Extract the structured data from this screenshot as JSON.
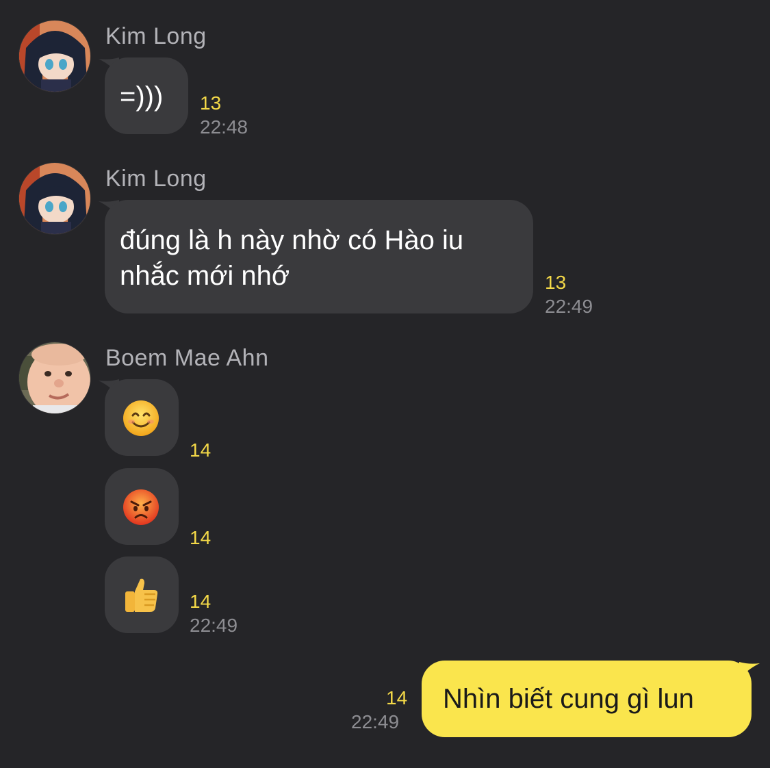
{
  "colors": {
    "background": "#252528",
    "bubble_other": "#3a3a3d",
    "bubble_mine": "#fae54d",
    "unread_count": "#f4d948",
    "timestamp": "#8d8d92",
    "sender_name": "#b3b3b8"
  },
  "messages": [
    {
      "sender": "Kim Long",
      "avatar": "anime-girl-avatar",
      "text": "=)))",
      "unread": "13",
      "time": "22:48"
    },
    {
      "sender": "Kim Long",
      "avatar": "anime-girl-avatar",
      "text_line1": "đúng là h này nhờ có Hào iu",
      "text_line2": "nhắc mới nhớ",
      "unread": "13",
      "time": "22:49"
    },
    {
      "sender": "Boem Mae Ahn",
      "avatar": "baby-face-avatar",
      "items": [
        {
          "emoji": "smiling-face-emoji",
          "unread": "14"
        },
        {
          "emoji": "angry-face-emoji",
          "unread": "14"
        },
        {
          "emoji": "thumbs-up-emoji",
          "unread": "14",
          "time": "22:49"
        }
      ]
    },
    {
      "sender": "me",
      "text": "Nhìn biết cung gì lun",
      "unread": "14",
      "time": "22:49"
    }
  ]
}
